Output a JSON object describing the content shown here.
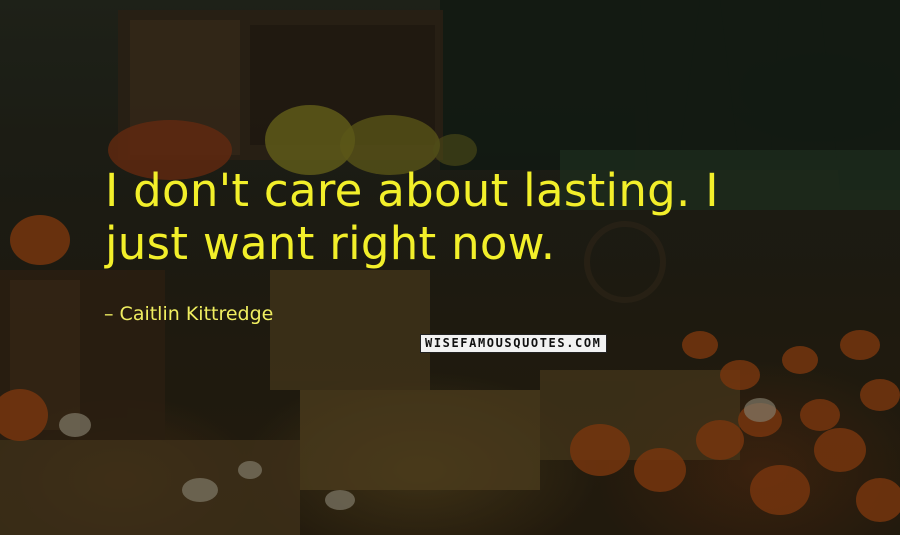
{
  "quote": {
    "line1": "I don't care about lasting. I",
    "line2": "just want right now."
  },
  "author": {
    "prefix": "–",
    "name": "Caitlin Kittredge"
  },
  "watermark": {
    "text": "WISEFAMOUSQUOTES.COM"
  },
  "colors": {
    "quote_text": "#f2ef2a",
    "author_text": "#f0ee60"
  }
}
